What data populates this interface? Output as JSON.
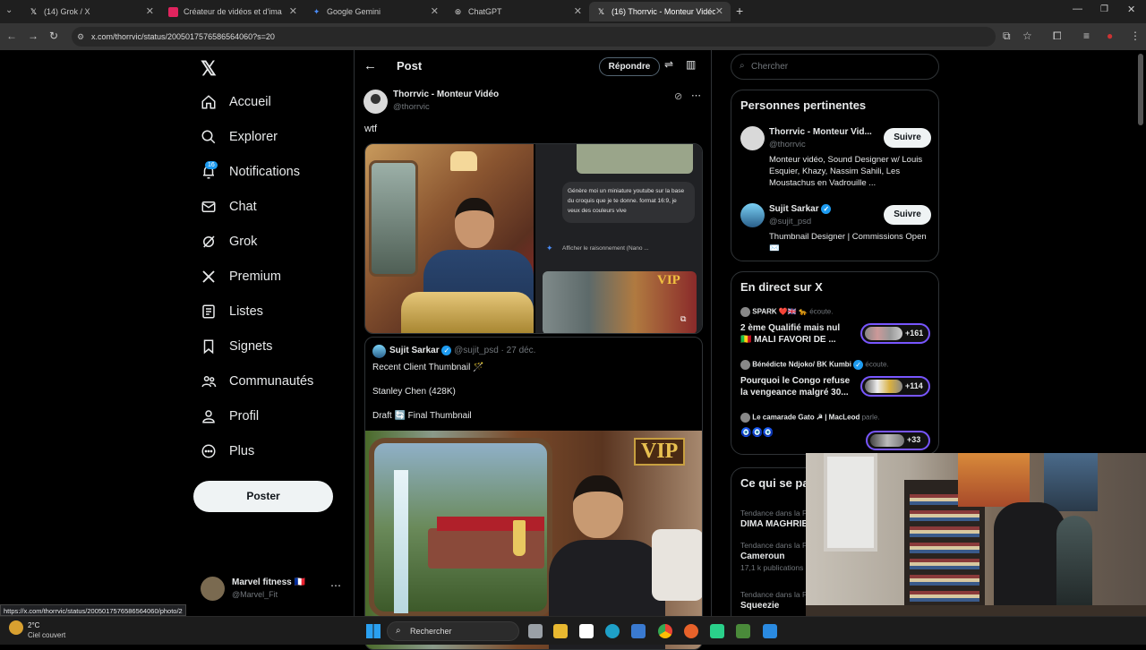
{
  "tabs": [
    {
      "label": "(14) Grok / X"
    },
    {
      "label": "Créateur de vidéos et d'images"
    },
    {
      "label": "Google Gemini"
    },
    {
      "label": "ChatGPT"
    },
    {
      "label": "(16) Thorrvic - Monteur Vidéo"
    }
  ],
  "browser": {
    "url": "x.com/thorrvic/status/2005017576586564060?s=20"
  },
  "nav": {
    "items": [
      {
        "label": "Accueil",
        "icon": "home-icon"
      },
      {
        "label": "Explorer",
        "icon": "search-icon"
      },
      {
        "label": "Notifications",
        "icon": "bell-icon",
        "badge": "16"
      },
      {
        "label": "Chat",
        "icon": "mail-icon"
      },
      {
        "label": "Grok",
        "icon": "grok-icon"
      },
      {
        "label": "Premium",
        "icon": "x-icon"
      },
      {
        "label": "Listes",
        "icon": "list-icon"
      },
      {
        "label": "Signets",
        "icon": "bookmark-icon"
      },
      {
        "label": "Communautés",
        "icon": "people-icon"
      },
      {
        "label": "Profil",
        "icon": "person-icon"
      },
      {
        "label": "Plus",
        "icon": "more-icon"
      }
    ],
    "post_button": "Poster",
    "account": {
      "name": "Marvel fitness 🇫🇷",
      "handle": "@Marvel_Fit"
    }
  },
  "post": {
    "header": "Post",
    "reply_button": "Répondre",
    "author": "Thorrvic - Monteur Vidéo",
    "handle": "@thorrvic",
    "text": "wtf",
    "chat_bubble": "Génère moi un miniature youtube sur la base du croquis que je te donne. format 16:9, je veux des couleurs vive",
    "reasoning": "Afficher le raisonnement (Nano ...",
    "vip": "VIP"
  },
  "quote": {
    "author": "Sujit Sarkar",
    "meta": "@sujit_psd · 27 déc.",
    "line1": "Recent Client Thumbnail 🪄",
    "line2": "Stanley Chen (428K)",
    "line3": "Draft 🔄 Final Thumbnail",
    "vip": "VIP"
  },
  "right": {
    "search_placeholder": "Chercher",
    "relevant_title": "Personnes pertinentes",
    "people": [
      {
        "name": "Thorrvic - Monteur Vid...",
        "handle": "@thorrvic",
        "bio": "Monteur vidéo, Sound Designer w/ Louis Esquier, Khazy, Nassim Sahili, Les Moustachus en Vadrouille ...",
        "button": "Suivre"
      },
      {
        "name": "Sujit Sarkar",
        "handle": "@sujit_psd",
        "bio": "Thumbnail Designer | Commissions Open ✉️",
        "button": "Suivre"
      }
    ],
    "live_title": "En direct sur X",
    "spaces": [
      {
        "host": "SPARK ❤️🇬🇧 🐆",
        "verb": "écoute.",
        "title": "2 ème Qualifié mais nul 🇲🇱 MALI FAVORI DE ...",
        "count": "+161"
      },
      {
        "host": "Bénédicte Ndjoko/ BK Kumbi",
        "verb": "écoute.",
        "title": "Pourquoi le Congo refuse la vengeance malgré 30...",
        "count": "+114"
      },
      {
        "host": "Le camarade Gato ☭ | MacLeod",
        "verb": "parle.",
        "title": "🧿🧿🧿",
        "count": "+33"
      }
    ],
    "trends_title": "Ce qui se passe",
    "trends": [
      {
        "context": "Tendance dans la France",
        "name": "DIMA MAGHRIB",
        "meta": ""
      },
      {
        "context": "Tendance dans la France",
        "name": "Cameroun",
        "meta": "17,1 k publications"
      },
      {
        "context": "Tendance dans la France",
        "name": "Squeezie",
        "meta": ""
      }
    ]
  },
  "status_url": "https://x.com/thorrvic/status/2005017576586564060/photo/2",
  "taskbar": {
    "temp": "2°C",
    "weather": "Ciel couvert",
    "search": "Rechercher"
  }
}
